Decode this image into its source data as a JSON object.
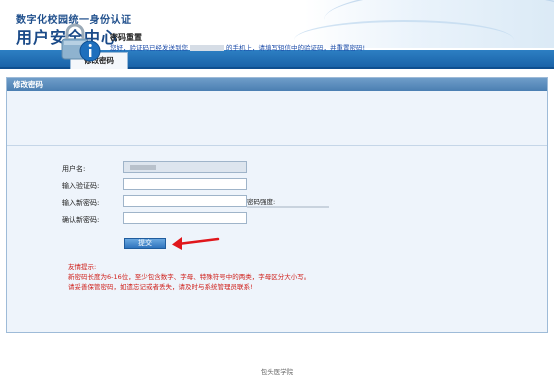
{
  "header": {
    "subtitle": "数字化校园统一身份认证",
    "title": "用户安全中心"
  },
  "nav": {
    "active_tab": "修改密码"
  },
  "panel": {
    "heading": "修改密码",
    "notice_title": "密码重置",
    "notice_text_before": "您好，验证码已经发送到您",
    "notice_text_after": "的手机上，请填写短信中的验证码，并重置密码!"
  },
  "form": {
    "username_label": "用户名:",
    "code_label": "输入验证码:",
    "new_password_label": "输入新密码:",
    "confirm_label": "确认新密码:",
    "strength_label": "密码强度:",
    "submit_label": "提交"
  },
  "tips": {
    "title": "友情提示:",
    "line1": "新密码长度为6-16位，至少包含数字、字母、特殊符号中的两类，字母区分大小写。",
    "line2": "请妥善保管密码，如遗忘记或者丢失，请及时与系统管理员联系!"
  },
  "footer": {
    "text": "包头医学院"
  },
  "colors": {
    "brand_blue": "#1a4a88",
    "nav_blue": "#1a63a8",
    "tip_red": "#d0201b",
    "arrow_red": "#e0161b"
  }
}
